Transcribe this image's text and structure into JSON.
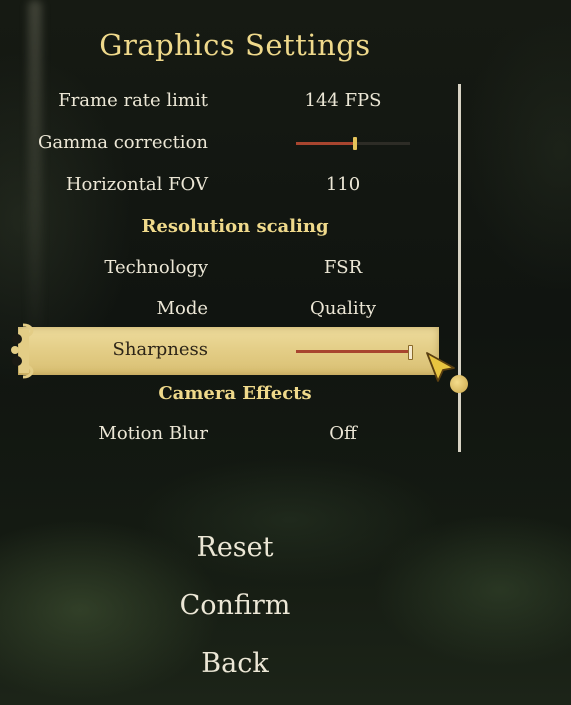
{
  "title": "Graphics Settings",
  "settings": [
    {
      "label": "Frame rate limit",
      "value": "144 FPS"
    },
    {
      "label": "Gamma correction",
      "slider_level": 0.52
    },
    {
      "label": "Horizontal FOV",
      "value": "110"
    }
  ],
  "resolution_section": {
    "heading": "Resolution scaling",
    "technology": {
      "label": "Technology",
      "value": "FSR"
    },
    "mode": {
      "label": "Mode",
      "value": "Quality"
    },
    "sharpness": {
      "label": "Sharpness",
      "slider_level": 1.0
    }
  },
  "camera_section": {
    "heading": "Camera Effects",
    "motion_blur": {
      "label": "Motion Blur",
      "value": "Off"
    }
  },
  "menu": {
    "reset": "Reset",
    "confirm": "Confirm",
    "back": "Back"
  },
  "colors": {
    "title_gold": "#efd98b",
    "slider_fill": "#a8452f",
    "highlight": "#e8d592",
    "text": "#ece7d6"
  },
  "icons": {
    "scroll_ornament": "scroll-ornament-icon",
    "cursor": "arrow-cursor-icon"
  }
}
